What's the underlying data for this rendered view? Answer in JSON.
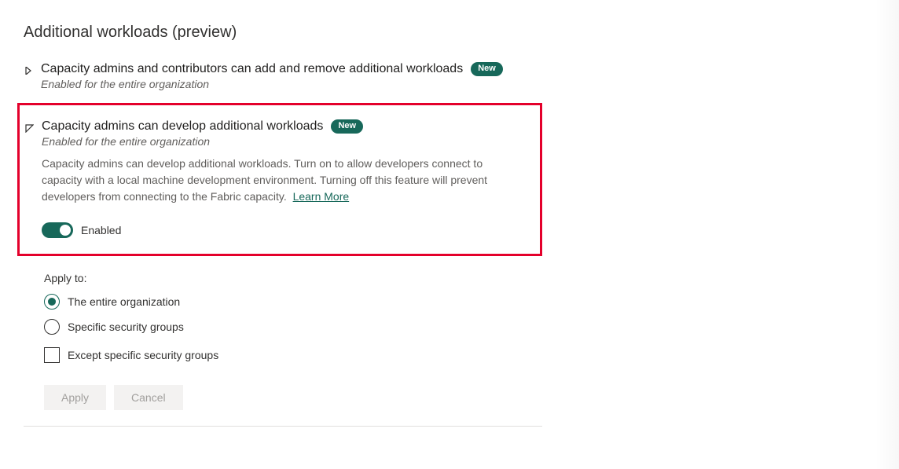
{
  "section_title": "Additional workloads (preview)",
  "settings": [
    {
      "title": "Capacity admins and contributors can add and remove additional workloads",
      "badge": "New",
      "subtitle": "Enabled for the entire organization"
    },
    {
      "title": "Capacity admins can develop additional workloads",
      "badge": "New",
      "subtitle": "Enabled for the entire organization",
      "description": "Capacity admins can develop additional workloads. Turn on to allow developers connect to capacity with a local machine development environment. Turning off this feature will prevent developers from connecting to the Fabric capacity.",
      "learn_more": "Learn More",
      "toggle_label": "Enabled"
    }
  ],
  "apply_to": {
    "label": "Apply to:",
    "options": [
      "The entire organization",
      "Specific security groups"
    ],
    "except_label": "Except specific security groups"
  },
  "buttons": {
    "apply": "Apply",
    "cancel": "Cancel"
  }
}
